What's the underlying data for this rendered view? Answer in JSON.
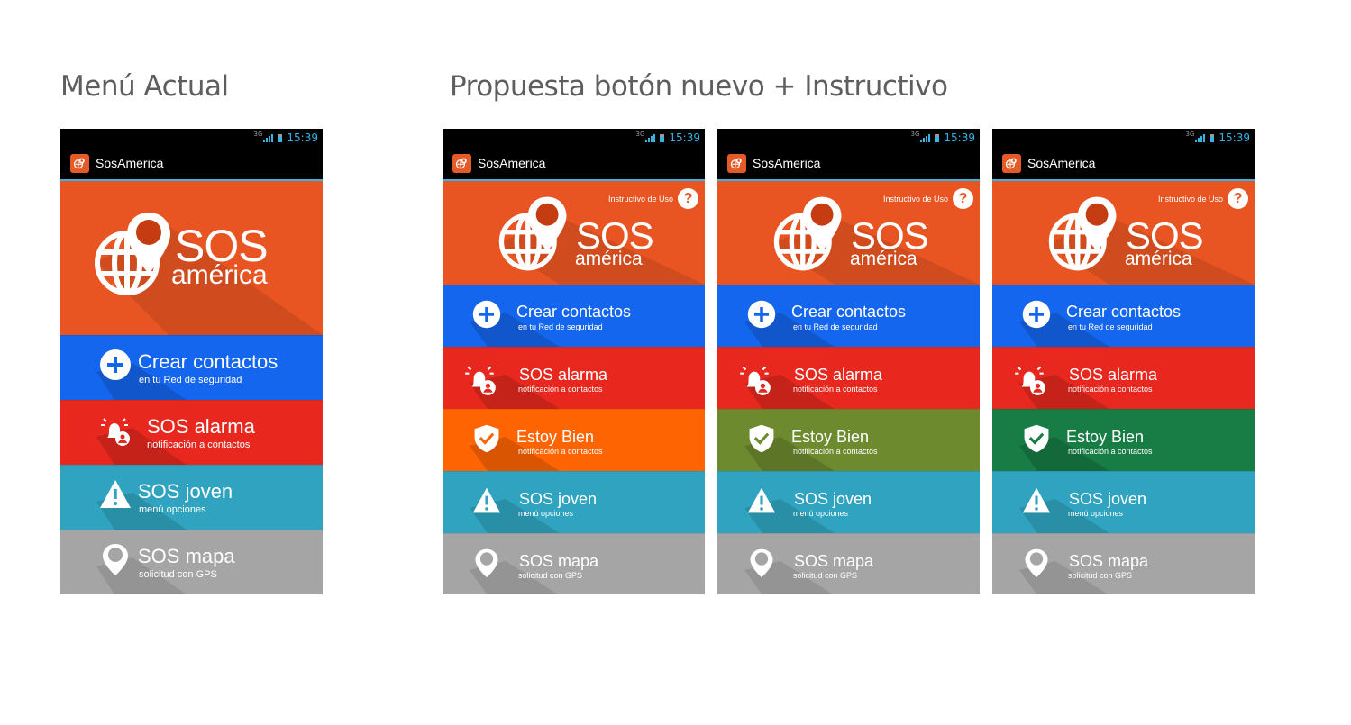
{
  "headings": {
    "current": "Menú Actual",
    "proposal": "Propuesta botón nuevo + Instructivo"
  },
  "status_bar": {
    "network": "3G",
    "time": "15:39"
  },
  "app": {
    "title": "SosAmerica"
  },
  "logo": {
    "line1": "SOS",
    "line2": "américa"
  },
  "help": {
    "label": "Instructivo de Uso",
    "icon_glyph": "?"
  },
  "menu": {
    "crear": {
      "title": "Crear contactos",
      "subtitle": "en tu Red de seguridad"
    },
    "alarma": {
      "title": "SOS alarma",
      "subtitle": "notificación a contactos"
    },
    "estoy_bien": {
      "title": "Estoy Bien",
      "subtitle": "notificación a contactos"
    },
    "joven": {
      "title": "SOS joven",
      "subtitle": "menú opciones"
    },
    "mapa": {
      "title": "SOS mapa",
      "subtitle": "solicitud con GPS"
    }
  },
  "colors": {
    "hero": "#e85522",
    "crear": "#1566ee",
    "alarma": "#e8281f",
    "joven": "#2fa3bf",
    "mapa": "#a5a5a5",
    "estoy_bien_variants": [
      "#ff6402",
      "#6e8a2e",
      "#187c45"
    ],
    "accent": "#33b5e5"
  },
  "icons": {
    "crear": "plus-circle-icon",
    "alarma": "bell-person-icon",
    "estoy_bien": "shield-check-icon",
    "joven": "warning-icon",
    "mapa": "map-pin-icon",
    "logo": "globe-pin-icon"
  }
}
